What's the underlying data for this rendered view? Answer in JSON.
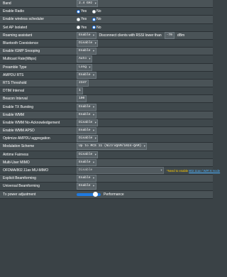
{
  "rows": {
    "band": {
      "label": "Band",
      "value": "2.4 GHz"
    },
    "enable_radio": {
      "label": "Enable Radio",
      "yes": "Yes",
      "no": "No",
      "selected": "yes"
    },
    "wireless_scheduler": {
      "label": "Enable wireless scheduler",
      "yes": "Yes",
      "no": "No",
      "selected": "no"
    },
    "ap_isolated": {
      "label": "Set AP Isolated",
      "yes": "Yes",
      "no": "No",
      "selected": "no"
    },
    "roaming": {
      "label": "Roaming assistant",
      "value": "Enable",
      "text": "Disconnect clients with RSSI lower than",
      "rssi": "-70",
      "unit": "dBm"
    },
    "bluetooth": {
      "label": "Bluetooth Coexistence",
      "value": "Disable"
    },
    "igmp": {
      "label": "Enable IGMP Snooping",
      "value": "Enable"
    },
    "multicast": {
      "label": "Multicast Rate(Mbps)",
      "value": "Auto"
    },
    "preamble": {
      "label": "Preamble Type",
      "value": "Long"
    },
    "ampdu_rts": {
      "label": "AMPDU RTS",
      "value": "Enable"
    },
    "rts_threshold": {
      "label": "RTS Threshold",
      "value": "2347"
    },
    "dtim": {
      "label": "DTIM Interval",
      "value": "1"
    },
    "beacon": {
      "label": "Beacon Interval",
      "value": "100"
    },
    "tx_bursting": {
      "label": "Enable TX Bursting",
      "value": "Enable"
    },
    "wmm": {
      "label": "Enable WMM",
      "value": "Enable"
    },
    "wmm_noack": {
      "label": "Enable WMM No-Acknowledgement",
      "value": "Disable"
    },
    "wmm_apsd": {
      "label": "Enable WMM APSD",
      "value": "Enable"
    },
    "ampdu_agg": {
      "label": "Optimize AMPDU aggregation",
      "value": "Disable"
    },
    "modulation": {
      "label": "Modulation Scheme",
      "value": "Up to MCS 11 (NitroQAM/1024-QAM)"
    },
    "airtime": {
      "label": "Airtime Fairness",
      "value": "Disable"
    },
    "mu_mimo": {
      "label": "Multi-User MIMO",
      "value": "Enable"
    },
    "ofdma": {
      "label": "OFDMA/802.11ax MU-MIMO",
      "value": "Disable",
      "note_prefix": "*Need to enable",
      "note_link": "802.11ax / WiFi 6 mode"
    },
    "explicit_bf": {
      "label": "Explicit Beamforming",
      "value": "Enable"
    },
    "universal_bf": {
      "label": "Universal Beamforming",
      "value": "Enable"
    },
    "tx_power": {
      "label": "Tx power adjustment",
      "value": "Performance",
      "level_fraction": 0.85
    }
  },
  "icons": {
    "dropdown": "chevron-down-icon"
  }
}
